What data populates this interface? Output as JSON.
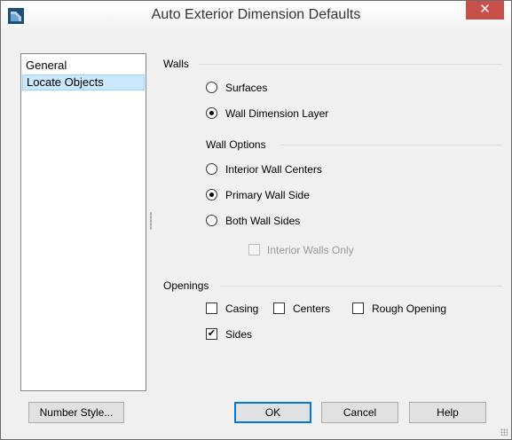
{
  "window": {
    "title": "Auto Exterior Dimension Defaults",
    "close_label": "✕",
    "accent_color": "#c7504b"
  },
  "nav": {
    "items": [
      {
        "label": "General",
        "selected": false
      },
      {
        "label": "Locate Objects",
        "selected": true
      }
    ]
  },
  "walls": {
    "group_label": "Walls",
    "options": [
      {
        "label": "Surfaces",
        "checked": false
      },
      {
        "label": "Wall Dimension Layer",
        "checked": true
      }
    ]
  },
  "wall_options": {
    "group_label": "Wall Options",
    "options": [
      {
        "label": "Interior Wall Centers",
        "checked": false
      },
      {
        "label": "Primary Wall Side",
        "checked": true
      },
      {
        "label": "Both Wall Sides",
        "checked": false
      }
    ],
    "interior_walls_only": {
      "label": "Interior Walls Only",
      "checked": false,
      "enabled": false
    }
  },
  "openings": {
    "group_label": "Openings",
    "checkboxes": [
      {
        "label": "Casing",
        "checked": false
      },
      {
        "label": "Centers",
        "checked": false
      },
      {
        "label": "Rough Opening",
        "checked": false
      },
      {
        "label": "Sides",
        "checked": true
      }
    ]
  },
  "buttons": {
    "number_style": "Number Style...",
    "ok": "OK",
    "cancel": "Cancel",
    "help": "Help"
  },
  "glyphs": {
    "checkmark": "✔"
  }
}
